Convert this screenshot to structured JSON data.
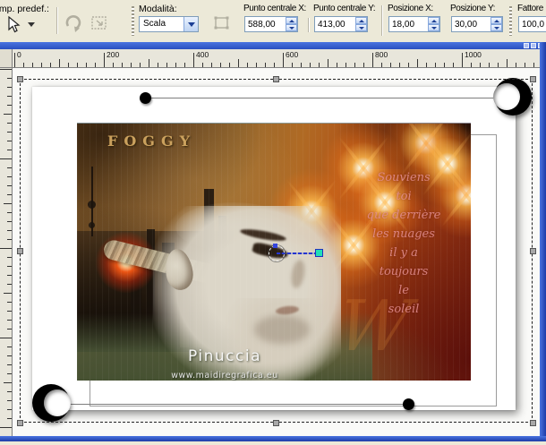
{
  "toolbar": {
    "preset_label": "Imp. predef.:",
    "mode_label": "Modalità:",
    "mode_value": "Scala",
    "fields": [
      {
        "label": "Punto centrale X:",
        "value": "588,00"
      },
      {
        "label": "Punto centrale Y:",
        "value": "413,00"
      },
      {
        "label": "Posizione X:",
        "value": "18,00"
      },
      {
        "label": "Posizione Y:",
        "value": "30,00"
      },
      {
        "label": "Fattore",
        "value": "100,0"
      }
    ]
  },
  "rulers": {
    "h": [
      "0",
      "200",
      "400",
      "600",
      "800",
      "1000"
    ]
  },
  "artwork": {
    "title": "FOGGY",
    "poem": [
      "Souviens",
      "toi",
      "que derrière",
      "les nuages",
      "il y a",
      "toujours",
      "le",
      "soleil"
    ],
    "signature": "Pinuccia",
    "watermark": "www.maidiregrafica.eu",
    "ghost": "W"
  },
  "colors": {
    "toolbar_bg": "#ece9d8",
    "window_border_blue": "#2a50c0",
    "selection_handle": "#a8a8a8",
    "pivot_handle": "#21dfb6",
    "foggy_text": "#caa05c",
    "poem_text": "#e49191"
  }
}
